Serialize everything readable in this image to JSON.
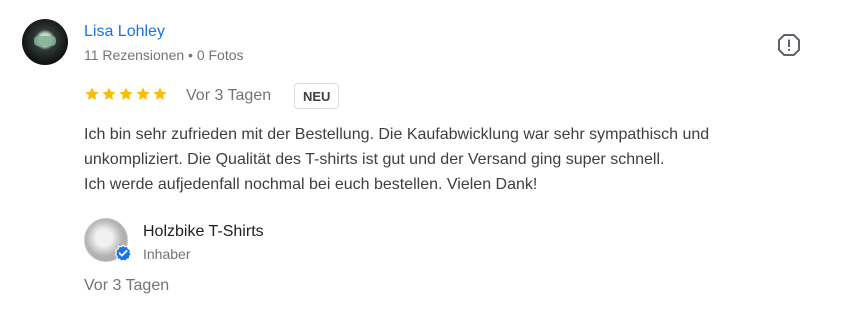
{
  "review": {
    "author": "Lisa Lohley",
    "meta": "11 Rezensionen • 0 Fotos",
    "rating": 5,
    "time": "Vor 3 Tagen",
    "badge": "NEU",
    "text": [
      "Ich bin sehr zufrieden mit der Bestellung. Die Kaufabwicklung war sehr sympathisch und",
      "unkompliziert. Die Qualität des T-shirts ist gut und der Versand ging super schnell.",
      "Ich werde aufjedenfall nochmal bei euch bestellen. Vielen Dank!"
    ]
  },
  "owner_reply": {
    "name": "Holzbike T-Shirts",
    "role": "Inhaber",
    "time": "Vor 3 Tagen"
  },
  "colors": {
    "star": "#fbbc04",
    "link": "#1a73e8",
    "verified": "#1a73e8"
  },
  "icons": [
    "report-flag-icon",
    "star-icon",
    "verified-check-icon"
  ]
}
